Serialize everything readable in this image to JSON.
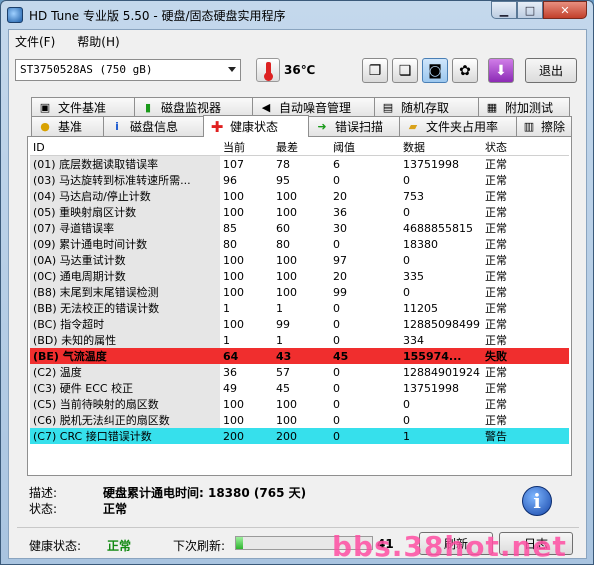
{
  "window": {
    "title": "HD Tune 专业版 5.50 - 硬盘/固态硬盘实用程序"
  },
  "menu": {
    "file": "文件(F)",
    "help": "帮助(H)"
  },
  "toolbar": {
    "drive": "ST3750528AS  (750 gB)",
    "temperature": "36℃",
    "exit_label": "退出"
  },
  "tabs_row1": [
    "文件基准",
    "磁盘监视器",
    "自动噪音管理",
    "随机存取",
    "附加测试"
  ],
  "tabs_row2": [
    "基准",
    "磁盘信息",
    "健康状态",
    "错误扫描",
    "文件夹占用率",
    "擦除"
  ],
  "grid": {
    "headers": {
      "id": "ID",
      "current": "当前",
      "worst": "最差",
      "threshold": "阈值",
      "data": "数据",
      "status": "状态"
    },
    "rows": [
      {
        "id": "(01) 底层数据读取错误率",
        "current": "107",
        "worst": "78",
        "threshold": "6",
        "data": "13751998",
        "status": "正常"
      },
      {
        "id": "(03) 马达旋转到标准转速所需...",
        "current": "96",
        "worst": "95",
        "threshold": "0",
        "data": "0",
        "status": "正常"
      },
      {
        "id": "(04) 马达启动/停止计数",
        "current": "100",
        "worst": "100",
        "threshold": "20",
        "data": "753",
        "status": "正常"
      },
      {
        "id": "(05) 重映射扇区计数",
        "current": "100",
        "worst": "100",
        "threshold": "36",
        "data": "0",
        "status": "正常"
      },
      {
        "id": "(07) 寻道错误率",
        "current": "85",
        "worst": "60",
        "threshold": "30",
        "data": "4688855815",
        "status": "正常"
      },
      {
        "id": "(09) 累计通电时间计数",
        "current": "80",
        "worst": "80",
        "threshold": "0",
        "data": "18380",
        "status": "正常"
      },
      {
        "id": "(0A) 马达重试计数",
        "current": "100",
        "worst": "100",
        "threshold": "97",
        "data": "0",
        "status": "正常"
      },
      {
        "id": "(0C) 通电周期计数",
        "current": "100",
        "worst": "100",
        "threshold": "20",
        "data": "335",
        "status": "正常"
      },
      {
        "id": "(B8) 末尾到末尾错误检测",
        "current": "100",
        "worst": "100",
        "threshold": "99",
        "data": "0",
        "status": "正常"
      },
      {
        "id": "(BB) 无法校正的错误计数",
        "current": "1",
        "worst": "1",
        "threshold": "0",
        "data": "11205",
        "status": "正常"
      },
      {
        "id": "(BC) 指令超时",
        "current": "100",
        "worst": "99",
        "threshold": "0",
        "data": "12885098499",
        "status": "正常"
      },
      {
        "id": "(BD) 未知的属性",
        "current": "1",
        "worst": "1",
        "threshold": "0",
        "data": "334",
        "status": "正常"
      },
      {
        "id": "(BE) 气流温度",
        "current": "64",
        "worst": "43",
        "threshold": "45",
        "data": "155974...",
        "status": "失败",
        "state": "failed"
      },
      {
        "id": "(C2) 温度",
        "current": "36",
        "worst": "57",
        "threshold": "0",
        "data": "12884901924",
        "status": "正常"
      },
      {
        "id": "(C3) 硬件 ECC 校正",
        "current": "49",
        "worst": "45",
        "threshold": "0",
        "data": "13751998",
        "status": "正常"
      },
      {
        "id": "(C5) 当前待映射的扇区数",
        "current": "100",
        "worst": "100",
        "threshold": "0",
        "data": "0",
        "status": "正常"
      },
      {
        "id": "(C6) 脱机无法纠正的扇区数",
        "current": "100",
        "worst": "100",
        "threshold": "0",
        "data": "0",
        "status": "正常"
      },
      {
        "id": "(C7) CRC 接口错误计数",
        "current": "200",
        "worst": "200",
        "threshold": "0",
        "data": "1",
        "status": "警告",
        "state": "warn"
      }
    ]
  },
  "description": {
    "desc_label": "描述:",
    "desc_value": "硬盘累计通电时间: 18380 (765 天)",
    "status_label": "状态:",
    "status_value": "正常"
  },
  "statusbar": {
    "health_label": "健康状态:",
    "health_value": "正常",
    "refresh_label": "下次刷新:",
    "refresh_progress": 0.05,
    "countdown": "41",
    "button_refresh": "刷新",
    "button_log": "日志"
  },
  "watermark": "bbs.38hot.net"
}
